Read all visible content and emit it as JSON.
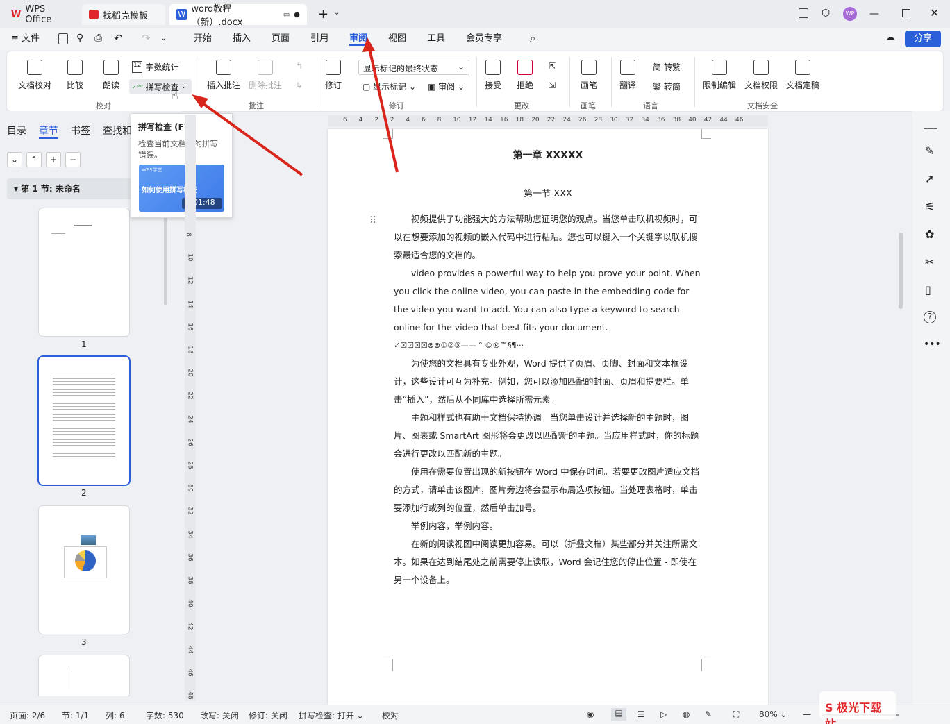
{
  "tabs": {
    "wps": "WPS Office",
    "template": "找稻壳模板",
    "doc": "word教程（新）.docx"
  },
  "menu": {
    "file": "文件",
    "items": [
      "开始",
      "插入",
      "页面",
      "引用",
      "审阅",
      "视图",
      "工具",
      "会员专享"
    ],
    "share": "分享"
  },
  "ribbon": {
    "proof": {
      "doc_check": "文档校对",
      "compare": "比较",
      "read": "朗读",
      "word_count": "字数统计",
      "spell_check": "拼写检查",
      "group": "校对"
    },
    "comment": {
      "insert": "插入批注",
      "delete": "删除批注",
      "group": "批注"
    },
    "revision": {
      "display_state": "显示标记的最终状态",
      "track": "修订",
      "show_markup": "显示标记",
      "review": "审阅",
      "group": "修订"
    },
    "changes": {
      "accept": "接受",
      "reject": "拒绝",
      "group": "更改"
    },
    "pen": {
      "pen": "画笔",
      "group": "画笔"
    },
    "lang": {
      "translate": "翻译",
      "to_trad": "简 转繁",
      "to_simp": "繁 转简",
      "group": "语言"
    },
    "security": {
      "restrict": "限制编辑",
      "rights": "文档权限",
      "finalize": "文档定稿",
      "group": "文档安全"
    }
  },
  "leftpane": {
    "tabs": [
      "目录",
      "章节",
      "书签",
      "查找和"
    ],
    "section": "第 1 节: 未命名",
    "pages": [
      "1",
      "2",
      "3"
    ]
  },
  "tooltip": {
    "title": "拼写检查 (F7)",
    "desc": "检查当前文档中的拼写错误。",
    "video_tag": "WPS学堂",
    "video_title": "如何使用拼写检查",
    "duration": "01:48"
  },
  "ruler": {
    "h": [
      "6",
      "4",
      "2",
      "2",
      "4",
      "6",
      "8",
      "10",
      "12",
      "14",
      "16",
      "18",
      "20",
      "22",
      "24",
      "26",
      "28",
      "30",
      "32",
      "34",
      "36",
      "38",
      "40",
      "42",
      "44",
      "46"
    ],
    "v": [
      "8",
      "10",
      "12",
      "14",
      "16",
      "18",
      "20",
      "22",
      "24",
      "26",
      "28",
      "30",
      "32",
      "34",
      "36",
      "38",
      "40",
      "42",
      "44",
      "46",
      "48"
    ]
  },
  "doc": {
    "chapter": "第一章  XXXXX",
    "section": "第一节  XXX",
    "p1": "视频提供了功能强大的方法帮助您证明您的观点。当您单击联机视频时，可以在想要添加的视频的嵌入代码中进行粘贴。您也可以键入一个关键字以联机搜索最适合您的文档的。",
    "p2": "video provides a powerful way to help you prove your point. When you click the online video, you can paste in the embedding code for the video you want to add. You can also type a keyword to search online for the video that best fits your document.",
    "p3": "✓☒☑☒☒⊗⊗①②③——  °  ©®™§¶···",
    "p4": "为使您的文档具有专业外观，Word 提供了页眉、页脚、封面和文本框设计，这些设计可互为补充。例如，您可以添加匹配的封面、页眉和提要栏。单击“插入”，然后从不同库中选择所需元素。",
    "p5": "主题和样式也有助于文档保持协调。当您单击设计并选择新的主题时，图片、图表或 SmartArt 图形将会更改以匹配新的主题。当应用样式时，你的标题会进行更改以匹配新的主题。",
    "p6": "使用在需要位置出现的新按钮在 Word 中保存时间。若要更改图片适应文档的方式，请单击该图片，图片旁边将会显示布局选项按钮。当处理表格时，单击要添加行或列的位置，然后单击加号。",
    "p7": "举例内容，举例内容。",
    "p8": "在新的阅读视图中阅读更加容易。可以（折叠文档）某些部分并关注所需文本。如果在达到结尾处之前需要停止读取，Word 会记住您的停止位置 - 即使在另一个设备上。"
  },
  "status": {
    "page": "页面: 2/6",
    "section": "节: 1/1",
    "col": "列: 6",
    "words": "字数: 530",
    "rewrite": "改写: 关闭",
    "revise": "修订: 关闭",
    "spell": "拼写检查: 打开",
    "proof": "校对",
    "zoom": "80%"
  },
  "accent": "#2b5fd9"
}
